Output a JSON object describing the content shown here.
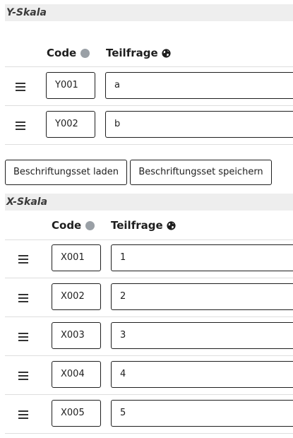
{
  "y_scale": {
    "title": "Y-Skala",
    "columns": {
      "code": "Code",
      "subquestion": "Teilfrage"
    },
    "rows": [
      {
        "code": "Y001",
        "text": "a"
      },
      {
        "code": "Y002",
        "text": "b"
      }
    ]
  },
  "label_buttons": {
    "load": "Beschriftungsset laden",
    "save": "Beschriftungsset speichern"
  },
  "x_scale": {
    "title": "X-Skala",
    "columns": {
      "code": "Code",
      "subquestion": "Teilfrage"
    },
    "rows": [
      {
        "code": "X001",
        "text": "1"
      },
      {
        "code": "X002",
        "text": "2"
      },
      {
        "code": "X003",
        "text": "3"
      },
      {
        "code": "X004",
        "text": "4"
      },
      {
        "code": "X005",
        "text": "5"
      }
    ]
  }
}
